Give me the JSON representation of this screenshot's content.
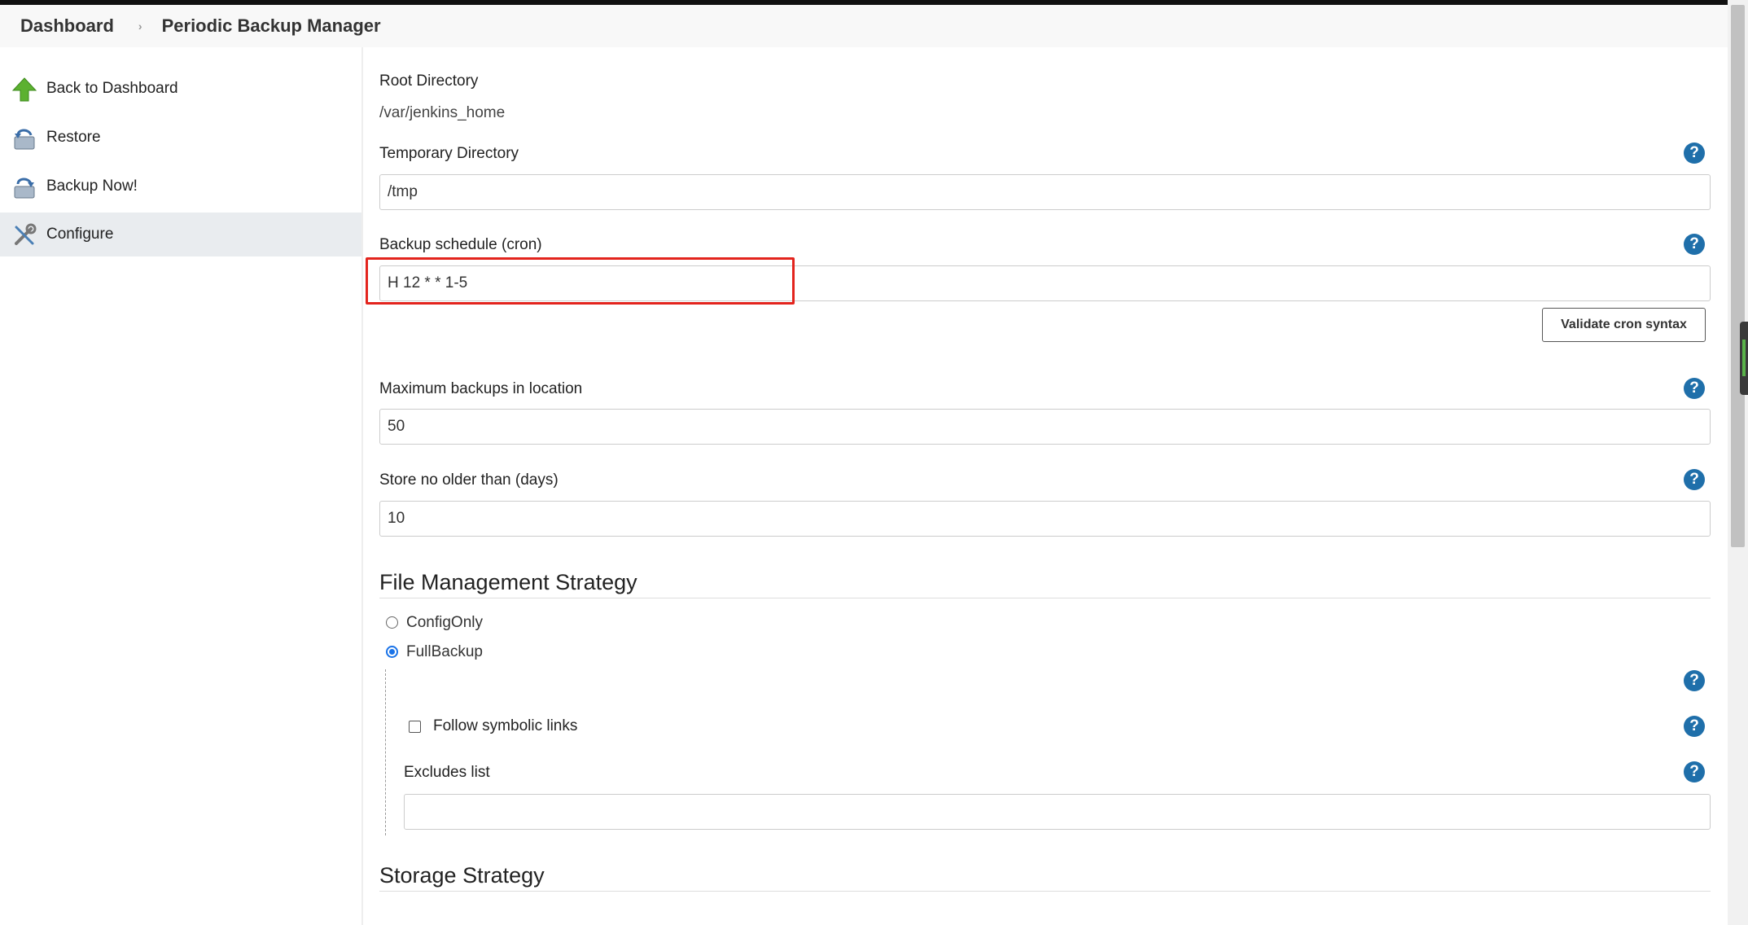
{
  "breadcrumb": {
    "dashboard": "Dashboard",
    "separator": "›",
    "current": "Periodic Backup Manager"
  },
  "sidebar": {
    "items": [
      {
        "label": "Back to Dashboard",
        "icon": "green-up-arrow-icon"
      },
      {
        "label": "Restore",
        "icon": "restore-icon"
      },
      {
        "label": "Backup Now!",
        "icon": "backup-icon"
      },
      {
        "label": "Configure",
        "icon": "configure-tools-icon",
        "active": true
      }
    ]
  },
  "form": {
    "root_directory": {
      "label": "Root Directory",
      "value": "/var/jenkins_home"
    },
    "temporary_directory": {
      "label": "Temporary Directory",
      "value": "/tmp"
    },
    "backup_schedule": {
      "label": "Backup schedule (cron)",
      "value": "H 12 * * 1-5"
    },
    "validate_button": "Validate cron syntax",
    "max_backups": {
      "label": "Maximum backups in location",
      "value": "50"
    },
    "store_no_older": {
      "label": "Store no older than (days)",
      "value": "10"
    },
    "help_glyph": "?"
  },
  "file_management": {
    "title": "File Management Strategy",
    "options": [
      {
        "label": "ConfigOnly",
        "selected": false
      },
      {
        "label": "FullBackup",
        "selected": true
      }
    ],
    "follow_symlinks": {
      "label": "Follow symbolic links",
      "checked": false
    },
    "excludes_list": {
      "label": "Excludes list",
      "value": ""
    }
  },
  "storage": {
    "title": "Storage Strategy"
  },
  "colors": {
    "highlight": "#e3241d",
    "help_icon": "#1f6faa",
    "radio_selected": "#1a73e8",
    "active_sidebar": "#e9ecef"
  }
}
